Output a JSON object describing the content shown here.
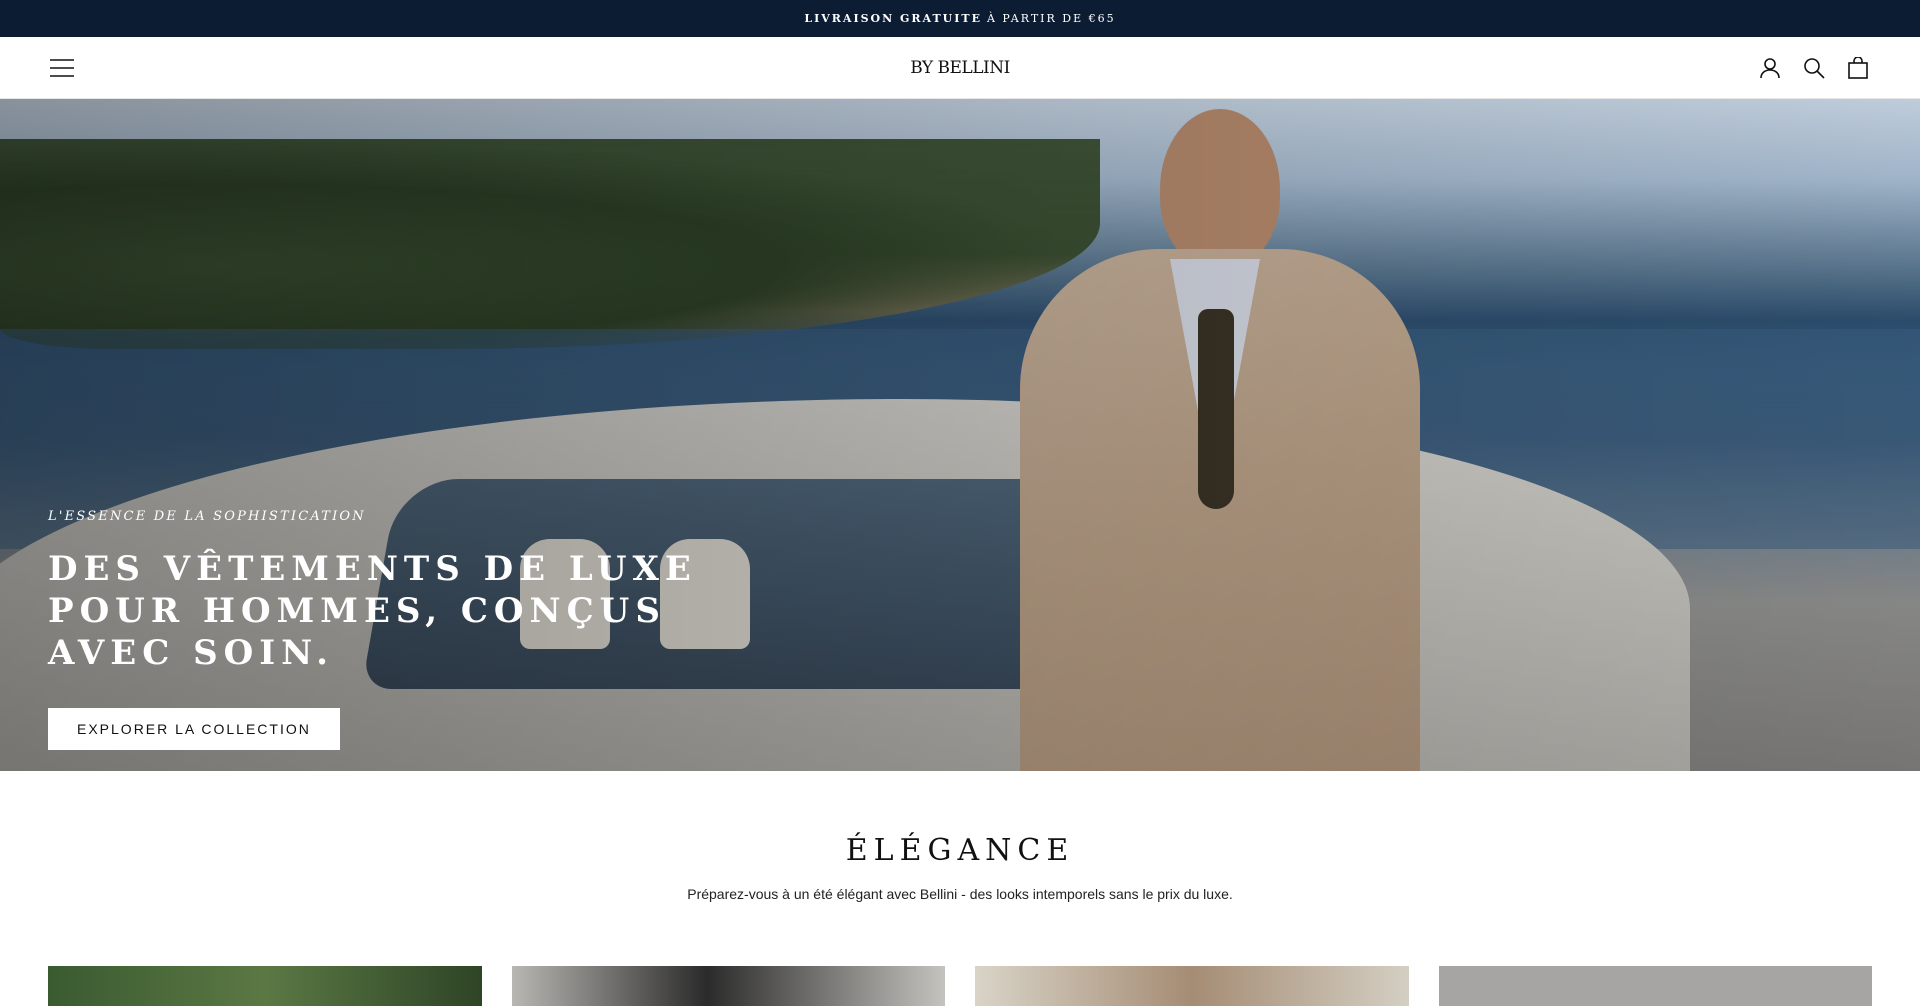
{
  "announcement": {
    "bold": "LIVRAISON GRATUITE",
    "rest": "À PARTIR DE €65"
  },
  "header": {
    "logo": "BY BELLINI"
  },
  "hero": {
    "eyebrow": "L'ESSENCE DE LA SOPHISTICATION",
    "title": "DES VÊTEMENTS DE LUXE POUR HOMMES, CONÇUS AVEC SOIN.",
    "cta": "EXPLORER LA COLLECTION"
  },
  "section": {
    "title": "ÉLÉGANCE",
    "subtitle": "Préparez-vous à un été élégant avec Bellini - des looks intemporels sans le prix du luxe."
  },
  "icons": [
    "menu-icon",
    "account-icon",
    "search-icon",
    "cart-icon"
  ]
}
